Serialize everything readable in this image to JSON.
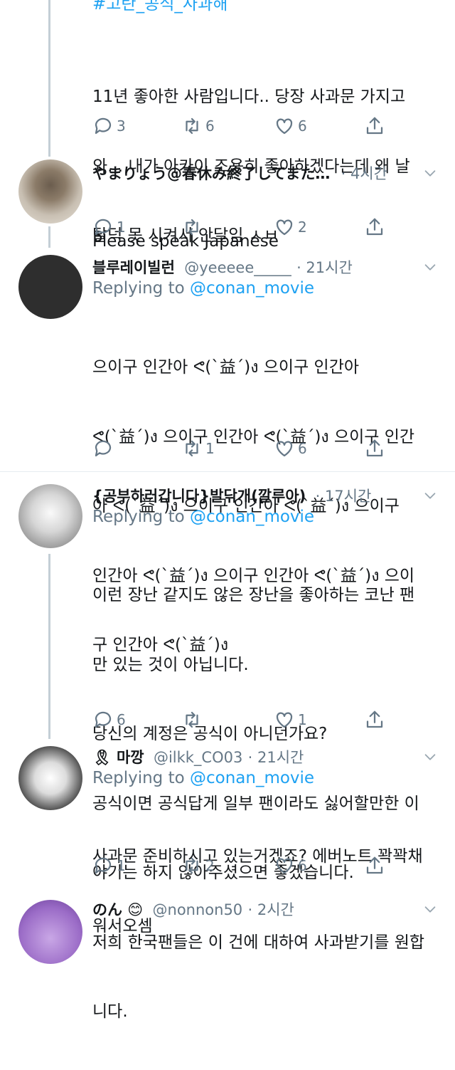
{
  "top_tweet": {
    "hashtag": "#고란_공식_사과해",
    "lines": [
      "11년 좋아한 사람입니다.. 당장 사과문 가지고",
      "와... 내가 아카이 조용히 좋아하겠다는데 왜 날",
      "탈덕 못 시켜서 안달임 ㅅㅂ"
    ],
    "replies": "3",
    "retweets": "6",
    "likes": "6"
  },
  "tweets": [
    {
      "name": "やまりょう@春休み終了してまた…",
      "handle": "",
      "time": "· 4시간",
      "replying_label": "",
      "replying_user": "",
      "lines": [
        "Please speak Japanese"
      ],
      "replies": "1",
      "retweets": "",
      "likes": "2"
    },
    {
      "name": "블루레이빌런",
      "handle": "@yeeeee_____",
      "time": "· 21시간",
      "replying_label": "Replying to",
      "replying_user": "@conan_movie",
      "lines": [
        "으이구 인간아 ᕙ(`益´)ง 으이구 인간아",
        "ᕙ(`益´)ง 으이구 인간아 ᕙ(`益´)ง 으이구 인간",
        "아 ᕙ(`益´)ง 으이구 인간아 ᕙ(`益´)ง 으이구",
        "인간아 ᕙ(`益´)ง 으이구 인간아 ᕙ(`益´)ง 으이",
        "구 인간아 ᕙ(`益´)ง"
      ],
      "replies": "",
      "retweets": "1",
      "likes": "6"
    },
    {
      "name": "{공부하러갑니다}발닦개(깔루아)",
      "handle": "",
      "time": "· 17시간",
      "replying_label": "Replying to",
      "replying_user": "@conan_movie",
      "lines": [
        "이런 장난 같지도 않은 장난을 좋아하는 코난 팬",
        "만 있는 것이 아닙니다.",
        "당신의 계정은 공식이 아니던가요?",
        "공식이면 공식답게 일부 팬이라도 싫어할만한 이",
        "야기는 하지 않아주셨으면 좋겠습니다.",
        "저희 한국팬들은 이 건에 대하여 사과받기를 원합",
        "니다."
      ],
      "replies": "6",
      "retweets": "",
      "likes": "1"
    },
    {
      "name": "🎗 마깡",
      "handle": "@ilkk_CO03",
      "time": "· 21시간",
      "replying_label": "Replying to",
      "replying_user": "@conan_movie",
      "lines": [
        "사과문 준비하시고 있는거겠죠? 에버노트 꽉꽉채",
        "워서오셈"
      ],
      "replies": "1",
      "retweets": "2",
      "likes": "6"
    },
    {
      "name": "のん 😊",
      "handle": "@nonnon50",
      "time": "· 2시간"
    }
  ],
  "colors": {
    "accent": "#1da1f2",
    "secondary_text": "#657786",
    "thread_line": "#c4cfd6",
    "divider": "#e6ecf0"
  },
  "icons": [
    "reply-icon",
    "retweet-icon",
    "like-icon",
    "share-icon",
    "chevron-down-icon"
  ]
}
